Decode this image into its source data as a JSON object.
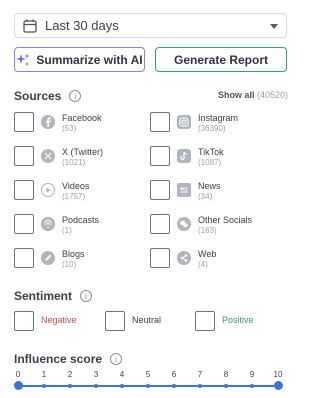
{
  "date_range": {
    "value": "Last 30 days"
  },
  "actions": {
    "summarize_label": "Summarize with AI",
    "report_label": "Generate Report"
  },
  "sources": {
    "title": "Sources",
    "show_all_label": "Show all",
    "show_all_count": "(40520)",
    "items": [
      {
        "label": "Facebook",
        "count": "(53)",
        "icon": "facebook-icon"
      },
      {
        "label": "Instagram",
        "count": "(36390)",
        "icon": "instagram-icon"
      },
      {
        "label": "X (Twitter)",
        "count": "(1021)",
        "icon": "x-twitter-icon"
      },
      {
        "label": "TikTok",
        "count": "(1087)",
        "icon": "tiktok-icon"
      },
      {
        "label": "Videos",
        "count": "(1757)",
        "icon": "play-icon"
      },
      {
        "label": "News",
        "count": "(34)",
        "icon": "newspaper-icon"
      },
      {
        "label": "Podcasts",
        "count": "(1)",
        "icon": "podcast-icon"
      },
      {
        "label": "Other Socials",
        "count": "(163)",
        "icon": "chat-bubbles-icon"
      },
      {
        "label": "Blogs",
        "count": "(10)",
        "icon": "blog-icon"
      },
      {
        "label": "Web",
        "count": "(4)",
        "icon": "share-icon"
      }
    ]
  },
  "sentiment": {
    "title": "Sentiment",
    "items": [
      {
        "label": "Negative",
        "color": "#c0504d"
      },
      {
        "label": "Neutral",
        "color": "#3a3f4b"
      },
      {
        "label": "Positive",
        "color": "#3d9a6a"
      }
    ]
  },
  "influence": {
    "title": "Influence score",
    "ticks": [
      "0",
      "1",
      "2",
      "3",
      "4",
      "5",
      "6",
      "7",
      "8",
      "9",
      "10"
    ],
    "min": 0,
    "max": 10,
    "selected_min": 0,
    "selected_max": 10,
    "accent": "#3b73d9"
  }
}
